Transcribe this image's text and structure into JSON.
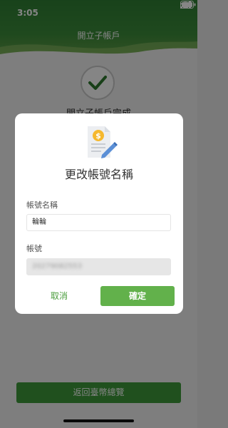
{
  "status_bar": {
    "time": "3:05",
    "icons": [
      "signal-icon",
      "wifi-icon",
      "battery-icon"
    ]
  },
  "header": {
    "title": "開立子帳戶"
  },
  "page": {
    "status_text": "開立子帳戶完成",
    "bottom_button": "返回臺幣總覽"
  },
  "dialog": {
    "icon": "document-edit-icon",
    "title": "更改帳號名稱",
    "name_label": "帳號名稱",
    "name_value": "輪輪",
    "account_label": "帳號",
    "account_value": "20279082553",
    "cancel_label": "取消",
    "confirm_label": "確定"
  },
  "colors": {
    "brand_green": "#3e9a3a",
    "confirm_green": "#62b14b",
    "cancel_text": "#4a9d3c"
  }
}
